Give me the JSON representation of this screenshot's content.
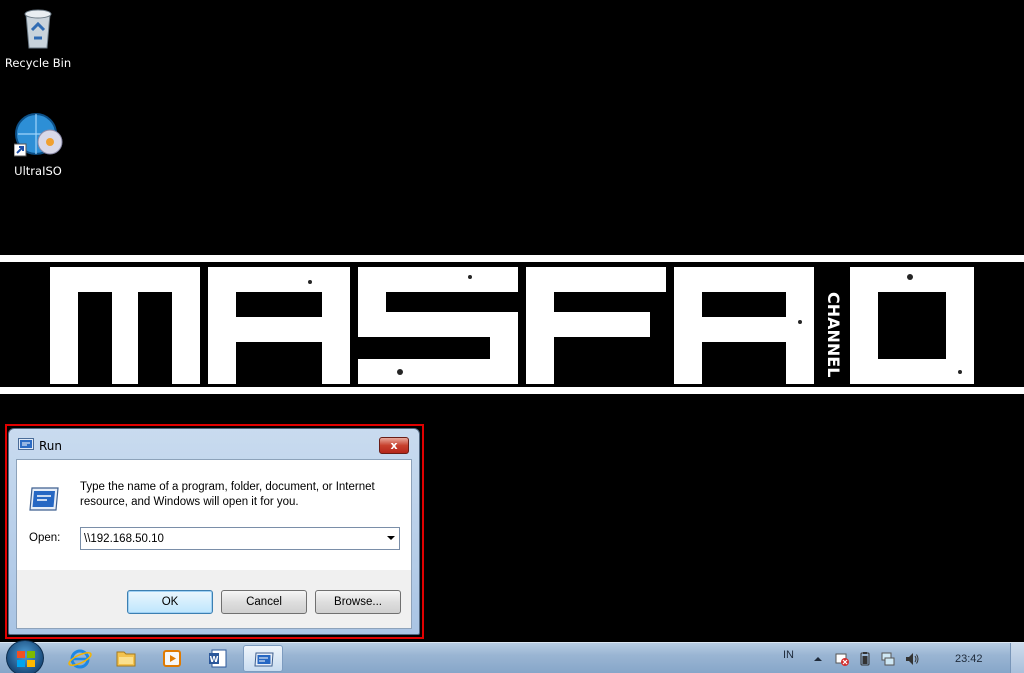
{
  "desktop": {
    "icons": [
      {
        "label": "Recycle Bin",
        "icon": "recycle-bin-icon"
      },
      {
        "label": "UltraISO",
        "icon": "ultraiso-icon"
      }
    ],
    "banner": {
      "text": "MASFAD",
      "subtext": "CHANNEL"
    }
  },
  "run_dialog": {
    "title": "Run",
    "close_label": "x",
    "description": "Type the name of a program, folder, document, or Internet resource, and Windows will open it for you.",
    "open_label": "Open:",
    "open_value": "\\\\192.168.50.10",
    "buttons": {
      "ok": "OK",
      "cancel": "Cancel",
      "browse": "Browse..."
    }
  },
  "taskbar": {
    "pinned": [
      "internet-explorer-icon",
      "windows-explorer-icon",
      "media-player-icon",
      "word-icon",
      "run-icon"
    ],
    "tray": {
      "language": "IN",
      "clock": "23:42"
    },
    "colors": {
      "taskbar": "#9ab5d3",
      "highlight": "#e00000"
    }
  }
}
